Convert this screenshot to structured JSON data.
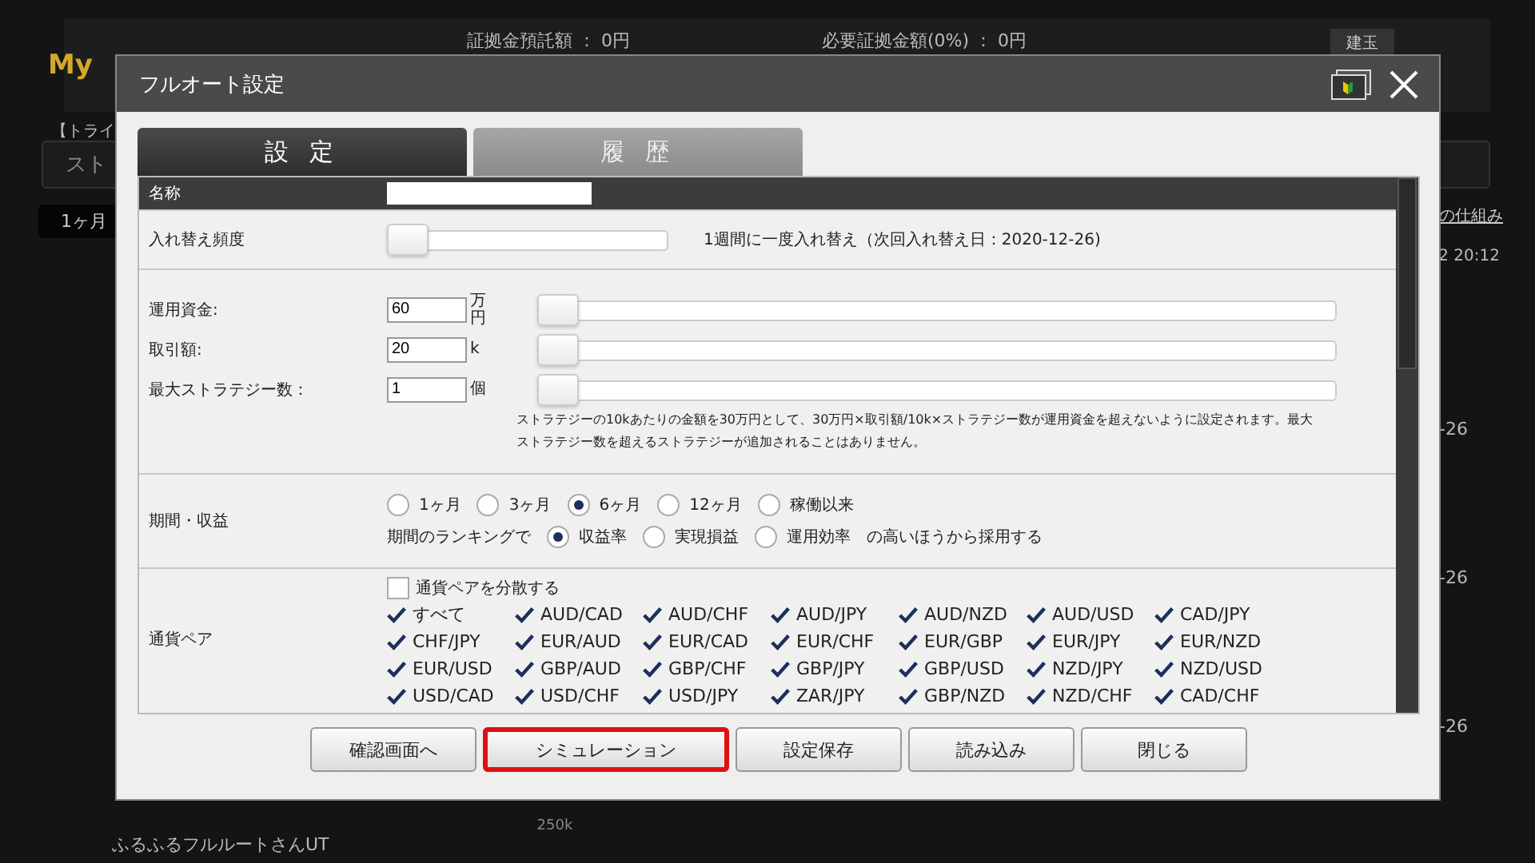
{
  "background": {
    "logo": "My",
    "deposit": "証拠金預託額 ： 0円",
    "margin": "必要証拠金額(0%) ： 0円",
    "position_tab": "建玉",
    "trial": "【トライ",
    "strategy_tab": "スト",
    "period_button": "1ヶ月",
    "link": "の仕組み",
    "time": "2 20:12",
    "dates": [
      "-26",
      "-26",
      "-26"
    ],
    "strategy_name": "ふるふるフルルートさんUT",
    "chart_tick": "250k"
  },
  "dialog": {
    "title": "フルオート設定",
    "tabs": [
      {
        "label": "設 定",
        "selected": true
      },
      {
        "label": "履 歴",
        "selected": false
      }
    ],
    "name": {
      "label": "名称"
    },
    "frequency": {
      "label": "入れ替え頻度",
      "level": 0,
      "text": "1週間に一度入れ替え（次回入れ替え日：2020-12-26)"
    },
    "capital": [
      {
        "label": "運用資金:",
        "value": "60",
        "unit": "万円",
        "level": 0
      },
      {
        "label": "取引額:",
        "value": "20",
        "unit": "k",
        "level": 0
      },
      {
        "label": "最大ストラテジー数：",
        "value": "1",
        "unit": "個",
        "level": 0
      }
    ],
    "note": "ストラテジーの10kあたりの金額を30万円として、30万円×取引額/10k×ストラテジー数が運用資金を超えないように設定されます。最大ストラテジー数を超えるストラテジーが追加されることはありません。",
    "period": {
      "label": "期間・収益",
      "options": [
        {
          "label": "1ヶ月",
          "selected": false
        },
        {
          "label": "3ヶ月",
          "selected": false
        },
        {
          "label": "6ヶ月",
          "selected": true
        },
        {
          "label": "12ヶ月",
          "selected": false
        },
        {
          "label": "稼働以来",
          "selected": false
        }
      ],
      "ranking_prefix": "期間のランキングで",
      "ranking": [
        {
          "label": "収益率",
          "selected": true
        },
        {
          "label": "実現損益",
          "selected": false
        },
        {
          "label": "運用効率",
          "selected": false
        }
      ],
      "ranking_suffix": "の高いほうから採用する"
    },
    "pairs": {
      "label": "通貨ペア",
      "diversify": {
        "label": "通貨ペアを分散する",
        "checked": false
      },
      "items": [
        {
          "label": "すべて",
          "checked": true
        },
        {
          "label": "AUD/CAD",
          "checked": true
        },
        {
          "label": "AUD/CHF",
          "checked": true
        },
        {
          "label": "AUD/JPY",
          "checked": true
        },
        {
          "label": "AUD/NZD",
          "checked": true
        },
        {
          "label": "AUD/USD",
          "checked": true
        },
        {
          "label": "CAD/JPY",
          "checked": true
        },
        {
          "label": "CHF/JPY",
          "checked": true
        },
        {
          "label": "EUR/AUD",
          "checked": true
        },
        {
          "label": "EUR/CAD",
          "checked": true
        },
        {
          "label": "EUR/CHF",
          "checked": true
        },
        {
          "label": "EUR/GBP",
          "checked": true
        },
        {
          "label": "EUR/JPY",
          "checked": true
        },
        {
          "label": "EUR/NZD",
          "checked": true
        },
        {
          "label": "EUR/USD",
          "checked": true
        },
        {
          "label": "GBP/AUD",
          "checked": true
        },
        {
          "label": "GBP/CHF",
          "checked": true
        },
        {
          "label": "GBP/JPY",
          "checked": true
        },
        {
          "label": "GBP/USD",
          "checked": true
        },
        {
          "label": "NZD/JPY",
          "checked": true
        },
        {
          "label": "NZD/USD",
          "checked": true
        },
        {
          "label": "USD/CAD",
          "checked": true
        },
        {
          "label": "USD/CHF",
          "checked": true
        },
        {
          "label": "USD/JPY",
          "checked": true
        },
        {
          "label": "ZAR/JPY",
          "checked": true
        },
        {
          "label": "GBP/NZD",
          "checked": true
        },
        {
          "label": "NZD/CHF",
          "checked": true
        },
        {
          "label": "CAD/CHF",
          "checked": true
        }
      ]
    },
    "buttons": [
      {
        "label": "確認画面へ",
        "highlighted": false
      },
      {
        "label": "シミュレーション",
        "highlighted": true
      },
      {
        "label": "設定保存",
        "highlighted": false
      },
      {
        "label": "読み込み",
        "highlighted": false
      },
      {
        "label": "閉じる",
        "highlighted": false
      }
    ]
  }
}
